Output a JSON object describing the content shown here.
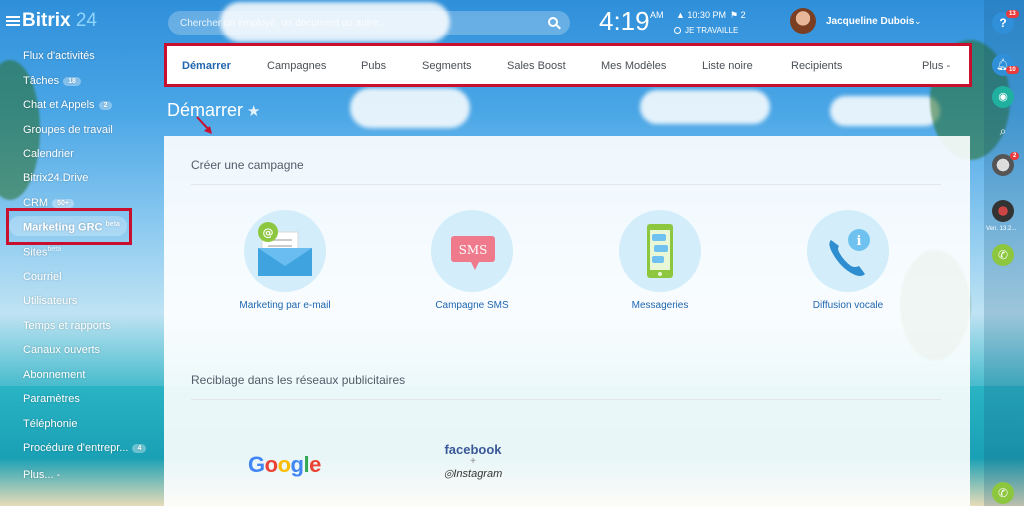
{
  "app": {
    "logo_name": "Bitrix",
    "logo_number": "24"
  },
  "search": {
    "placeholder": "Chercher un employé, un document ou autre..."
  },
  "clock": {
    "time": "4:19",
    "ampm": "AM",
    "alarm": "10:30 PM",
    "tasks": "2",
    "work_status": "JE TRAVAILLE"
  },
  "user": {
    "name": "Jacqueline Dubois"
  },
  "sidebar": {
    "items": [
      {
        "label": "Flux d'activités"
      },
      {
        "label": "Tâches",
        "badge": "18"
      },
      {
        "label": "Chat et Appels",
        "badge": "2"
      },
      {
        "label": "Groupes de travail"
      },
      {
        "label": "Calendrier"
      },
      {
        "label": "Bitrix24.Drive"
      },
      {
        "label": "CRM",
        "badge": "50+"
      },
      {
        "label": "Marketing GRC",
        "sup": "beta"
      },
      {
        "label": "Sites",
        "sup": "beta"
      },
      {
        "label": "Courriel"
      },
      {
        "label": "Utilisateurs"
      },
      {
        "label": "Temps et rapports"
      },
      {
        "label": "Canaux ouverts"
      },
      {
        "label": "Abonnement"
      },
      {
        "label": "Paramètres"
      },
      {
        "label": "Téléphonie"
      },
      {
        "label": "Procédure d'entrepr...",
        "badge": "4"
      },
      {
        "label": "Plus... -"
      }
    ]
  },
  "tabs": [
    {
      "label": "Démarrer",
      "active": true
    },
    {
      "label": "Campagnes"
    },
    {
      "label": "Pubs"
    },
    {
      "label": "Segments"
    },
    {
      "label": "Sales Boost"
    },
    {
      "label": "Mes Modèles"
    },
    {
      "label": "Liste noire"
    },
    {
      "label": "Recipients"
    },
    {
      "label": "Plus -"
    }
  ],
  "page": {
    "title": "Démarrer"
  },
  "create_section": {
    "title": "Créer une campagne",
    "cards": [
      {
        "label": "Marketing par e-mail",
        "icon": "email-envelope-icon"
      },
      {
        "label": "Campagne SMS",
        "icon": "sms-bubble-icon",
        "icon_text": "SMS"
      },
      {
        "label": "Messageries",
        "icon": "messenger-phone-icon"
      },
      {
        "label": "Diffusion vocale",
        "icon": "voice-call-icon"
      }
    ]
  },
  "retarget_section": {
    "title": "Reciblage dans les réseaux publicitaires",
    "google": "Google",
    "facebook": "facebook",
    "plus": "+",
    "instagram": "Instagram"
  },
  "right_rail": {
    "help_badge": "13",
    "notif_badge": "10",
    "chat_badge": "2",
    "date": "Ven. 13.2..."
  },
  "colors": {
    "accent_blue": "#2067b0",
    "highlight_red": "#c8102e",
    "google_blue": "#4285F4",
    "google_red": "#EA4335",
    "google_yellow": "#FBBC05",
    "google_green": "#34A853",
    "facebook_blue": "#3b5998"
  }
}
